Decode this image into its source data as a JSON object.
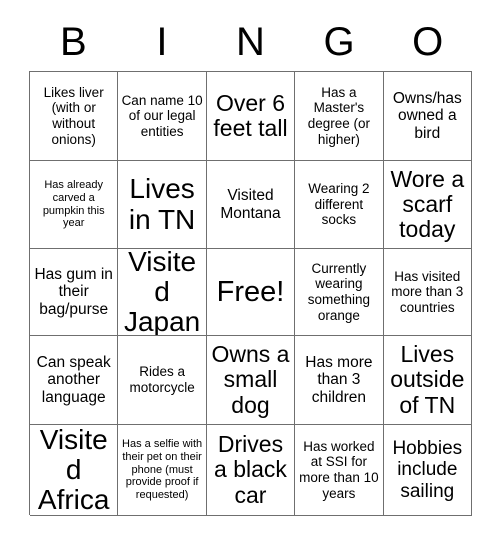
{
  "card": {
    "title": "BINGO",
    "header_letters": [
      "B",
      "I",
      "N",
      "G",
      "O"
    ],
    "grid_size": "5x5",
    "free_space_label": "Free!",
    "colors": {
      "text": "#000000",
      "background": "#ffffff",
      "grid_line": "#6f6f6f"
    },
    "cells": [
      {
        "row": 1,
        "col": 1,
        "column_letter": "B",
        "text": "Likes liver (with or without onions)",
        "size": "sm",
        "free": false
      },
      {
        "row": 1,
        "col": 2,
        "column_letter": "I",
        "text": "Can name 10 of our legal entities",
        "size": "sm",
        "free": false
      },
      {
        "row": 1,
        "col": 3,
        "column_letter": "N",
        "text": "Over 6 feet tall",
        "size": "xl",
        "free": false
      },
      {
        "row": 1,
        "col": 4,
        "column_letter": "G",
        "text": "Has a Master's degree (or higher)",
        "size": "sm",
        "free": false
      },
      {
        "row": 1,
        "col": 5,
        "column_letter": "O",
        "text": "Owns/has owned a bird",
        "size": "md",
        "free": false
      },
      {
        "row": 2,
        "col": 1,
        "column_letter": "B",
        "text": "Has already carved a pumpkin this year",
        "size": "xs",
        "free": false
      },
      {
        "row": 2,
        "col": 2,
        "column_letter": "I",
        "text": "Lives in TN",
        "size": "xxl",
        "free": false
      },
      {
        "row": 2,
        "col": 3,
        "column_letter": "N",
        "text": "Visited Montana",
        "size": "md",
        "free": false
      },
      {
        "row": 2,
        "col": 4,
        "column_letter": "G",
        "text": "Wearing 2 different socks",
        "size": "sm",
        "free": false
      },
      {
        "row": 2,
        "col": 5,
        "column_letter": "O",
        "text": "Wore a scarf today",
        "size": "xl",
        "free": false
      },
      {
        "row": 3,
        "col": 1,
        "column_letter": "B",
        "text": "Has gum in their bag/purse",
        "size": "md",
        "free": false
      },
      {
        "row": 3,
        "col": 2,
        "column_letter": "I",
        "text": "Visited Japan",
        "size": "xxl",
        "free": false
      },
      {
        "row": 3,
        "col": 3,
        "column_letter": "N",
        "text": "Free!",
        "size": "free",
        "free": true
      },
      {
        "row": 3,
        "col": 4,
        "column_letter": "G",
        "text": "Currently wearing something orange",
        "size": "sm",
        "free": false
      },
      {
        "row": 3,
        "col": 5,
        "column_letter": "O",
        "text": "Has visited more than 3 countries",
        "size": "sm",
        "free": false
      },
      {
        "row": 4,
        "col": 1,
        "column_letter": "B",
        "text": "Can speak another language",
        "size": "md",
        "free": false
      },
      {
        "row": 4,
        "col": 2,
        "column_letter": "I",
        "text": "Rides a motorcycle",
        "size": "sm",
        "free": false
      },
      {
        "row": 4,
        "col": 3,
        "column_letter": "N",
        "text": "Owns a small dog",
        "size": "xl",
        "free": false
      },
      {
        "row": 4,
        "col": 4,
        "column_letter": "G",
        "text": "Has more than 3 children",
        "size": "md",
        "free": false
      },
      {
        "row": 4,
        "col": 5,
        "column_letter": "O",
        "text": "Lives outside of TN",
        "size": "xl",
        "free": false
      },
      {
        "row": 5,
        "col": 1,
        "column_letter": "B",
        "text": "Visited Africa",
        "size": "xxl",
        "free": false
      },
      {
        "row": 5,
        "col": 2,
        "column_letter": "I",
        "text": "Has a selfie with their pet on their phone (must provide proof if requested)",
        "size": "xs",
        "free": false
      },
      {
        "row": 5,
        "col": 3,
        "column_letter": "N",
        "text": "Drives a black car",
        "size": "xl",
        "free": false
      },
      {
        "row": 5,
        "col": 4,
        "column_letter": "G",
        "text": "Has worked at SSI for more than 10 years",
        "size": "sm",
        "free": false
      },
      {
        "row": 5,
        "col": 5,
        "column_letter": "O",
        "text": "Hobbies include sailing",
        "size": "lg",
        "free": false
      }
    ]
  }
}
